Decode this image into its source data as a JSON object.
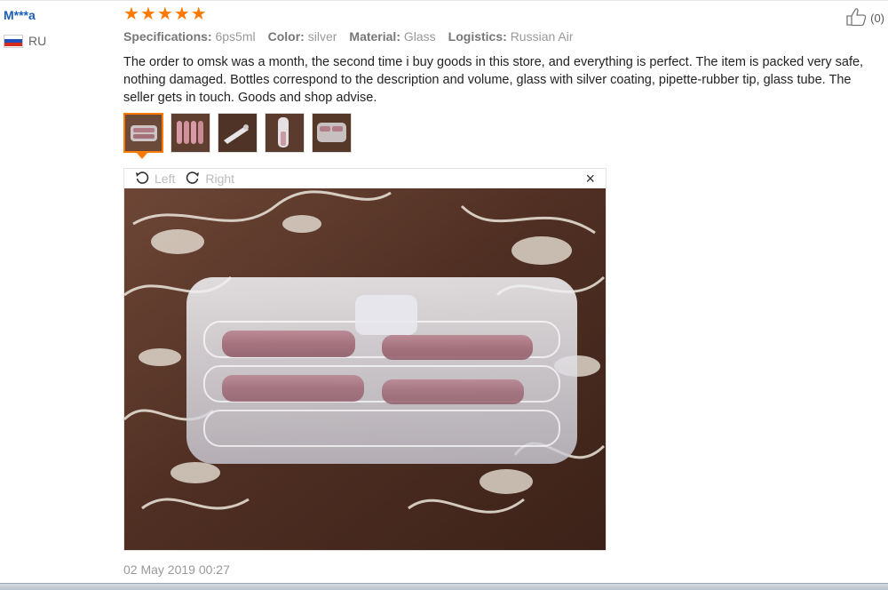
{
  "review": {
    "user_name": "M***a",
    "country": "RU",
    "rating_stars": 5,
    "helpful_count": "(0)",
    "specs": [
      {
        "key": "Specifications:",
        "value": "6ps5ml"
      },
      {
        "key": "Color:",
        "value": "silver"
      },
      {
        "key": "Material:",
        "value": "Glass"
      },
      {
        "key": "Logistics:",
        "value": "Russian Air"
      }
    ],
    "text": "The order to omsk was a month, the second time i buy goods in this store, and everything is perfect. The item is packed very safe, nothing damaged. Bottles correspond to the description and volume, glass with silver coating, pipette-rubber tip, glass tube. The seller gets in touch. Goods and shop advise.",
    "thumbnail_count": 5,
    "selected_thumbnail": 1,
    "date": "02 May 2019 00:27"
  },
  "viewer": {
    "rotate_left_label": "Left",
    "rotate_right_label": "Right",
    "close_glyph": "×"
  },
  "colors": {
    "star": "#ff7a00",
    "username": "#1a5fb4",
    "accent": "#ff7a00"
  },
  "icons": {
    "rotate_left": "rotate-left-icon",
    "rotate_right": "rotate-right-icon",
    "close": "close-icon",
    "thumbs_up": "thumbs-up-icon",
    "flag": "russia-flag-icon",
    "star": "star-icon"
  }
}
